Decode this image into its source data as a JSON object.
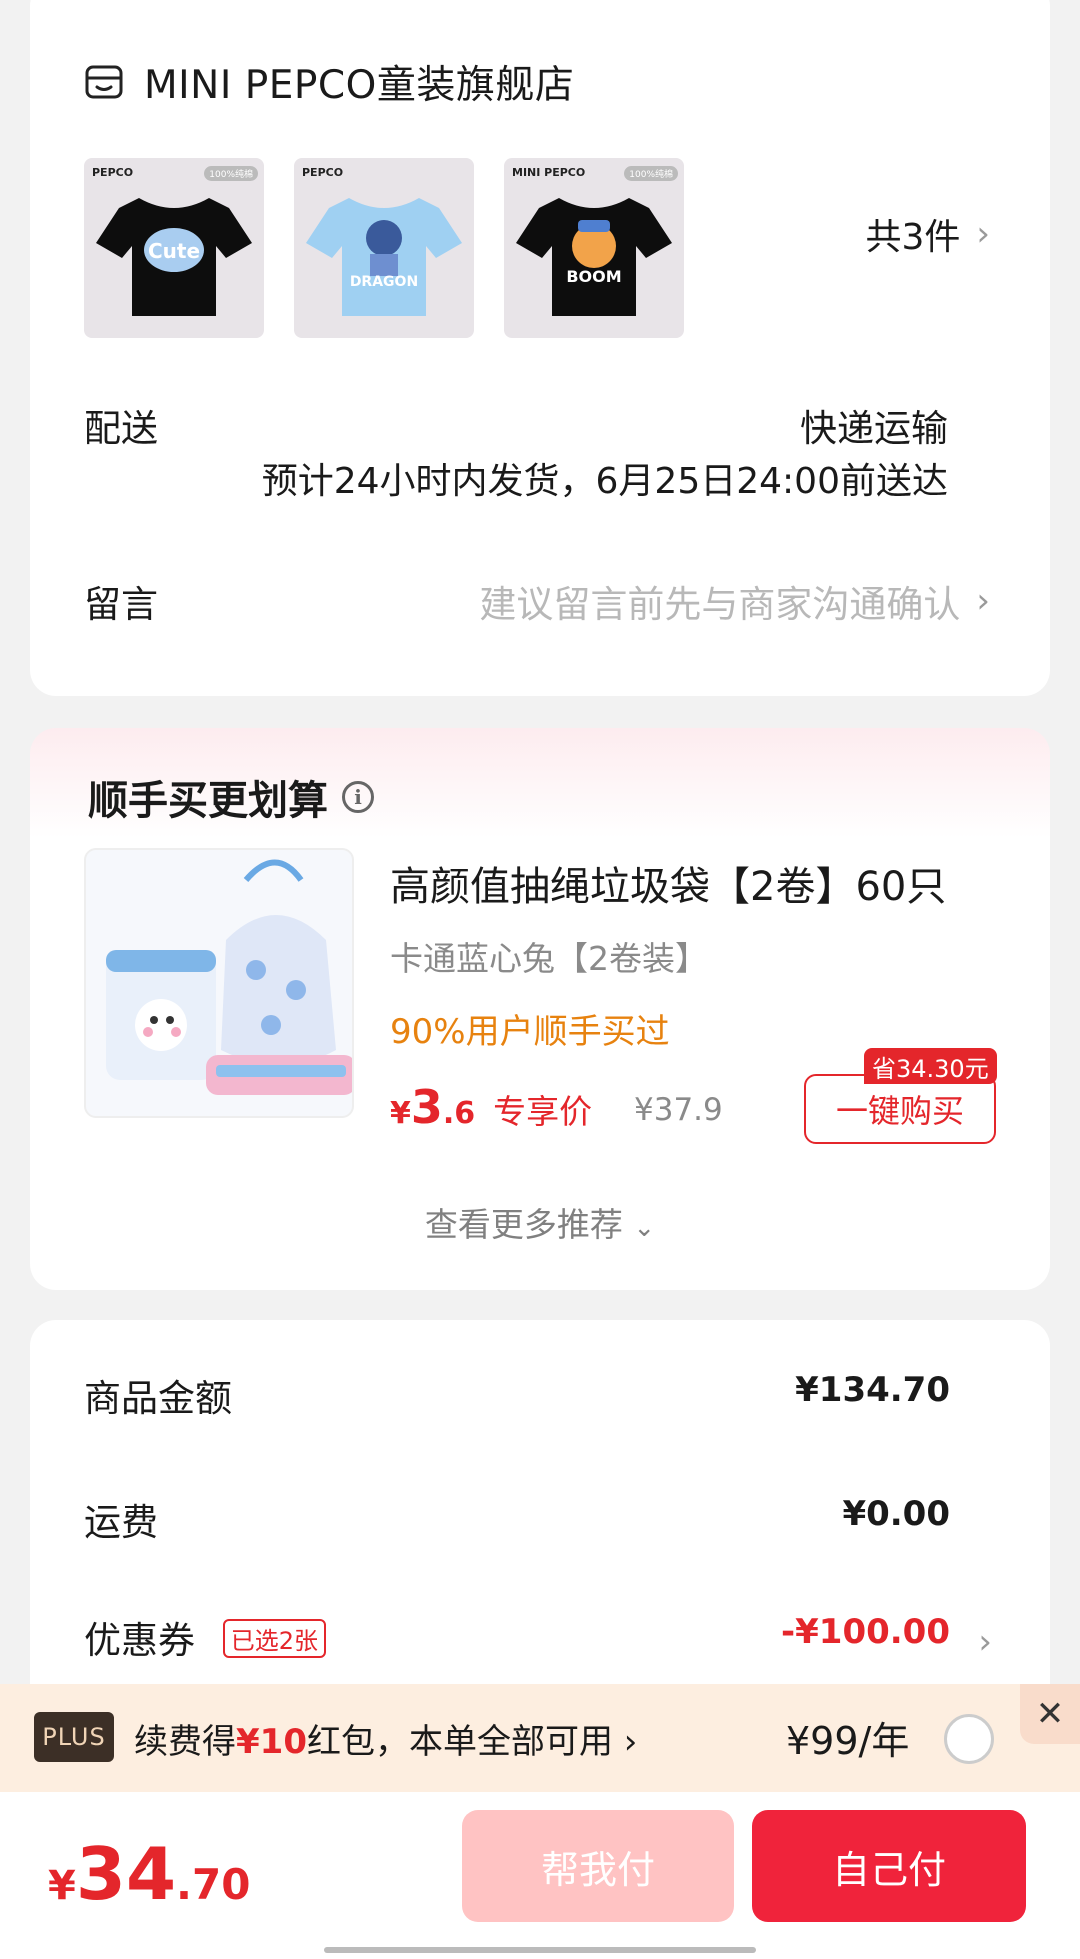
{
  "store": {
    "name": "MINI PEPCO童装旗舰店",
    "icon": "store-icon",
    "items": [
      {
        "logo": "PEPCO",
        "tag": "100%纯棉",
        "color": "#000000",
        "print_color": "#a9cdf0"
      },
      {
        "logo": "PEPCO",
        "tag": "",
        "color": "#9fd0f2",
        "print_color": "#3a5a9b"
      },
      {
        "logo": "MINI PEPCO",
        "tag": "100%纯棉",
        "color": "#000000",
        "print_color": "#f2a34a"
      }
    ],
    "count_text": "共3件"
  },
  "delivery": {
    "label": "配送",
    "method": "快递运输",
    "eta": "预计24小时内发货，6月25日24:00前送达"
  },
  "message": {
    "label": "留言",
    "placeholder": "建议留言前先与商家沟通确认"
  },
  "recommend": {
    "title": "顺手买更划算",
    "product": {
      "name": "高颜值抽绳垃圾袋【2卷】60只",
      "spec": "卡通蓝心兔【2卷装】",
      "social": "90%用户顺手买过",
      "price_symbol": "¥",
      "price_int": "3",
      "price_dec": ".6",
      "price_label": "专享价",
      "original_price": "¥37.9",
      "save_badge": "省34.30元",
      "buy_label": "一键购买"
    },
    "more_label": "查看更多推荐"
  },
  "amounts": {
    "goods_label": "商品金额",
    "goods_value": "¥134.70",
    "shipping_label": "运费",
    "shipping_value": "¥0.00",
    "coupon_label": "优惠券",
    "coupon_tag": "已选2张",
    "coupon_value": "-¥100.00"
  },
  "plus": {
    "badge": "PLUS",
    "text_prefix": "续费得",
    "text_amount": "¥10",
    "text_suffix": "红包，本单全部可用",
    "price": "¥99/年"
  },
  "bottom": {
    "total_symbol": "¥",
    "total_int": "34",
    "total_dec": ".70",
    "help_pay_label": "帮我付",
    "self_pay_label": "自己付"
  },
  "colors": {
    "accent": "#e4262b",
    "pay_button": "#f0233b",
    "help_button": "#ffc3c3",
    "social_proof": "#e7820f"
  }
}
